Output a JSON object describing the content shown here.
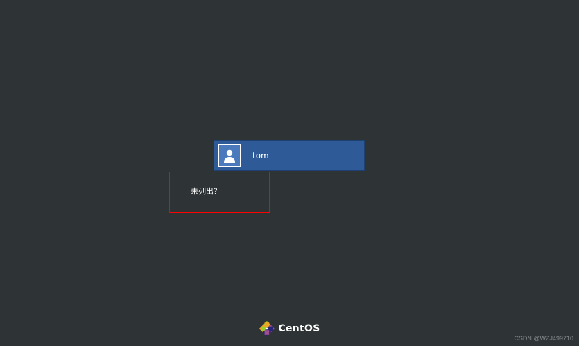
{
  "login": {
    "user_name": "tom",
    "not_listed_label": "未列出？"
  },
  "branding": {
    "name": "CentOS"
  },
  "watermark": "CSDN @WZJ499710"
}
